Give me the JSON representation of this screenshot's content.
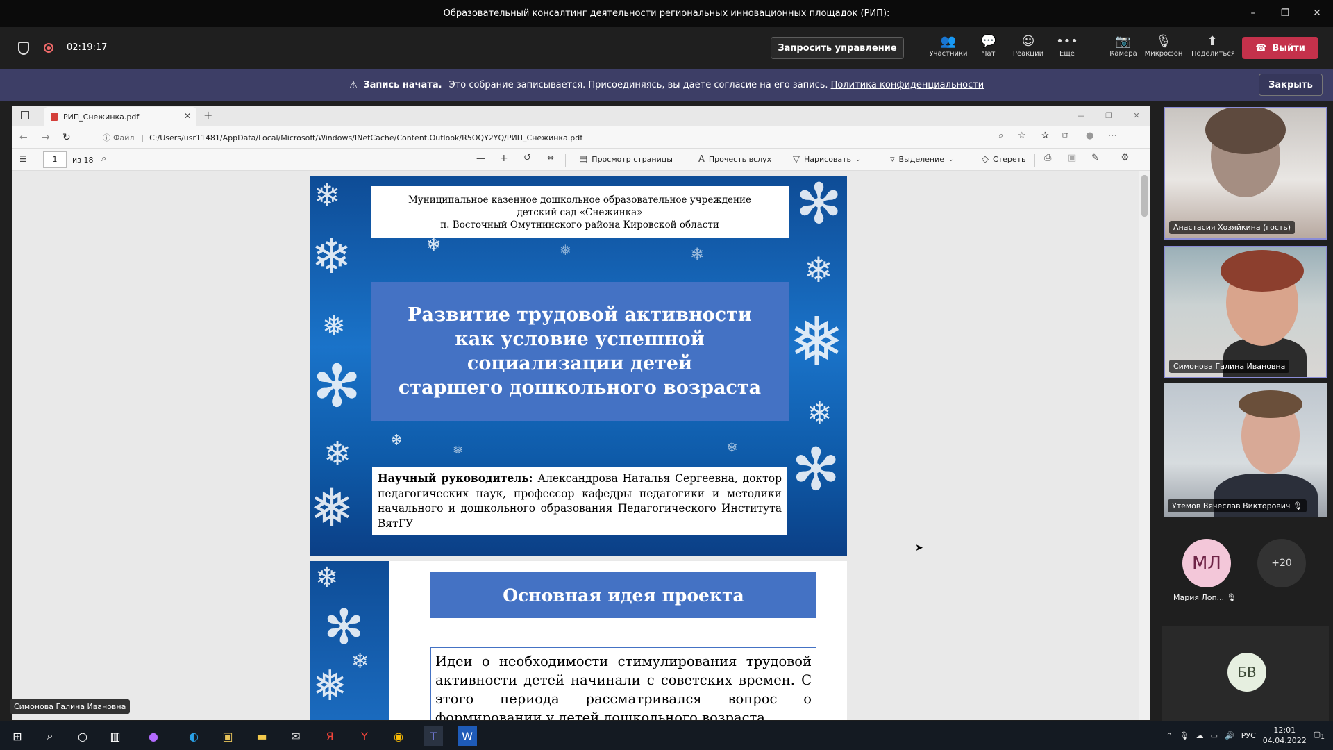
{
  "window": {
    "title": "Образовательный консалтинг деятельности региональных инновационных площадок (РИП):",
    "controls": [
      "–",
      "❐",
      "✕"
    ]
  },
  "meeting": {
    "timer": "02:19:17",
    "request_control": "Запросить управление",
    "tools": [
      {
        "icon": "participants-icon",
        "glyph": "👥",
        "label": "Участники"
      },
      {
        "icon": "chat-icon",
        "glyph": "💬",
        "label": "Чат"
      },
      {
        "icon": "reactions-icon",
        "glyph": "☺",
        "label": "Реакции"
      },
      {
        "icon": "more-icon",
        "glyph": "•••",
        "label": "Еще"
      },
      {
        "icon": "camera-off-icon",
        "glyph": "📷",
        "label": "Камера"
      },
      {
        "icon": "mic-off-icon",
        "glyph": "🎙",
        "label": "Микрофон"
      },
      {
        "icon": "share-icon",
        "glyph": "⬆",
        "label": "Поделиться"
      }
    ],
    "leave": "Выйти"
  },
  "banner": {
    "bold": "Запись начата.",
    "text": "Это собрание записывается. Присоединяясь, вы даете согласие на его запись.",
    "link": "Политика конфиденциальности",
    "close": "Закрыть"
  },
  "browser": {
    "tab_title": "РИП_Снежинка.pdf",
    "address_label": "Файл",
    "url": "C:/Users/usr11481/AppData/Local/Microsoft/Windows/INetCache/Content.Outlook/R5OQY2YQ/РИП_Снежинка.pdf",
    "page": "1",
    "page_total": "из 18",
    "toolbar": {
      "page_view": "Просмотр страницы",
      "read_aloud": "Прочесть вслух",
      "draw": "Нарисовать",
      "highlight": "Выделение",
      "erase": "Стереть"
    }
  },
  "slide1": {
    "institution": "Муниципальное казенное дошкольное образовательное учреждение детский сад «Снежинка» п. Восточный Омутнинского района Кировской области",
    "inst_lines": [
      "Муниципальное казенное дошкольное образовательное учреждение",
      "детский сад «Снежинка»",
      "п. Восточный Омутнинского района Кировской области"
    ],
    "title_lines": [
      "Развитие трудовой активности",
      "как условие успешной",
      "социализации детей",
      "старшего дошкольного возраста"
    ],
    "advisor_label": "Научный руководитель:",
    "advisor_text": " Александрова Наталья Сергеевна, доктор педагогических наук, профессор кафедры педагогики и методики начального и дошкольного образования Педагогического Института ВятГУ"
  },
  "slide2": {
    "heading": "Основная идея проекта",
    "text": "Идеи о необходимости стимулирования трудовой активности детей начинали с советских времен. С этого периода рассматривался вопрос о формировании у детей дошкольного возраста"
  },
  "presenter_label": "Симонова Галина Ивановна",
  "participants": {
    "video": [
      {
        "name": "Анастасия Хозяйкина (гость)"
      },
      {
        "name": "Симонова Галина Ивановна"
      },
      {
        "name": "Утёмов Вячеслав Викторович"
      }
    ],
    "avatar_ml": {
      "initials": "МЛ",
      "name": "Мария Лоп..."
    },
    "more_count": "+20",
    "avatar_bv": {
      "initials": "БВ"
    }
  },
  "taskbar": {
    "lang": "РУС",
    "time": "12:01",
    "date": "04.04.2022",
    "notifications": "1"
  },
  "colors": {
    "leave": "#c4314b",
    "banner": "#3d3e66",
    "slide_blue": "#4472c4",
    "active_speaker": "#8a8cd6"
  }
}
